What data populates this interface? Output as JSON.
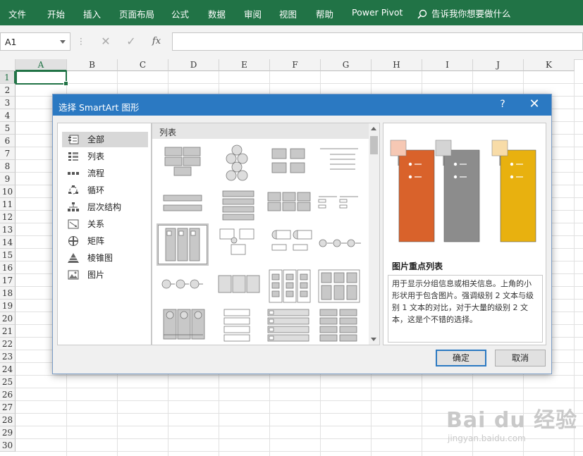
{
  "ribbon": {
    "tabs": [
      "文件",
      "开始",
      "插入",
      "页面布局",
      "公式",
      "数据",
      "审阅",
      "视图",
      "帮助",
      "Power Pivot"
    ],
    "tell_me": "告诉我你想要做什么"
  },
  "formula_bar": {
    "name_box": "A1",
    "fx": "fx",
    "cancel": "✕",
    "enter": "✓"
  },
  "sheet": {
    "columns": [
      "A",
      "B",
      "C",
      "D",
      "E",
      "F",
      "G",
      "H",
      "I",
      "J",
      "K"
    ],
    "rows": [
      "1",
      "2",
      "3",
      "4",
      "5",
      "6",
      "7",
      "8",
      "9",
      "10",
      "11",
      "12",
      "13",
      "14",
      "15",
      "16",
      "17",
      "18",
      "19",
      "20",
      "21",
      "22",
      "23",
      "24",
      "25",
      "26",
      "27",
      "28",
      "29",
      "30"
    ],
    "selected_cell": "A1"
  },
  "dialog": {
    "title": "选择 SmartArt 图形",
    "help": "?",
    "close": "✕",
    "categories": [
      {
        "label": "全部",
        "icon": "all-icon"
      },
      {
        "label": "列表",
        "icon": "list-icon"
      },
      {
        "label": "流程",
        "icon": "process-icon"
      },
      {
        "label": "循环",
        "icon": "cycle-icon"
      },
      {
        "label": "层次结构",
        "icon": "hierarchy-icon"
      },
      {
        "label": "关系",
        "icon": "relationship-icon"
      },
      {
        "label": "矩阵",
        "icon": "matrix-icon"
      },
      {
        "label": "棱锥图",
        "icon": "pyramid-icon"
      },
      {
        "label": "图片",
        "icon": "picture-icon"
      }
    ],
    "section_header": "列表",
    "preview": {
      "title": "图片重点列表",
      "description": "用于显示分组信息或相关信息。上角的小形状用于包含图片。强调级别 2 文本与级别 1 文本的对比，对于大量的级别 2 文本，这是个不错的选择。",
      "colors": [
        "#d9622b",
        "#8c8c8c",
        "#e8b10f"
      ]
    },
    "ok": "确定",
    "cancel": "取消"
  },
  "watermark": {
    "big": "Bai du 经验",
    "small": "jingyan.baidu.com"
  }
}
